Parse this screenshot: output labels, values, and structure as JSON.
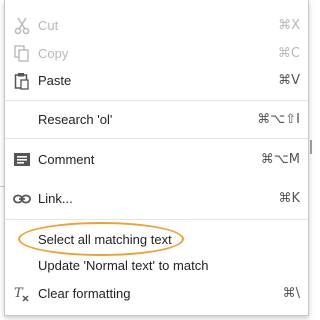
{
  "context_menu": {
    "items": [
      {
        "label": "Cut",
        "shortcut": "⌘X",
        "icon": "scissors-icon",
        "disabled": true
      },
      {
        "label": "Copy",
        "shortcut": "⌘C",
        "icon": "copy-icon",
        "disabled": true
      },
      {
        "label": "Paste",
        "shortcut": "⌘V",
        "icon": "clipboard-icon",
        "disabled": false
      },
      {
        "label": "Research 'ol'",
        "shortcut": "⌘⌥⇧I",
        "icon": "",
        "disabled": false
      },
      {
        "label": "Comment",
        "shortcut": "⌘⌥M",
        "icon": "comment-icon",
        "disabled": false
      },
      {
        "label": "Link...",
        "shortcut": "⌘K",
        "icon": "link-icon",
        "disabled": false
      },
      {
        "label": "Select all matching text",
        "shortcut": "",
        "icon": "",
        "disabled": false,
        "highlighted": true
      },
      {
        "label": "Update 'Normal text' to match",
        "shortcut": "",
        "icon": "",
        "disabled": false
      },
      {
        "label": "Clear formatting",
        "shortcut": "⌘\\",
        "icon": "clear-formatting-icon",
        "disabled": false
      }
    ]
  },
  "colors": {
    "highlight_ring": "#f0a030",
    "disabled_text": "#b8b8b8",
    "text": "#222222"
  }
}
